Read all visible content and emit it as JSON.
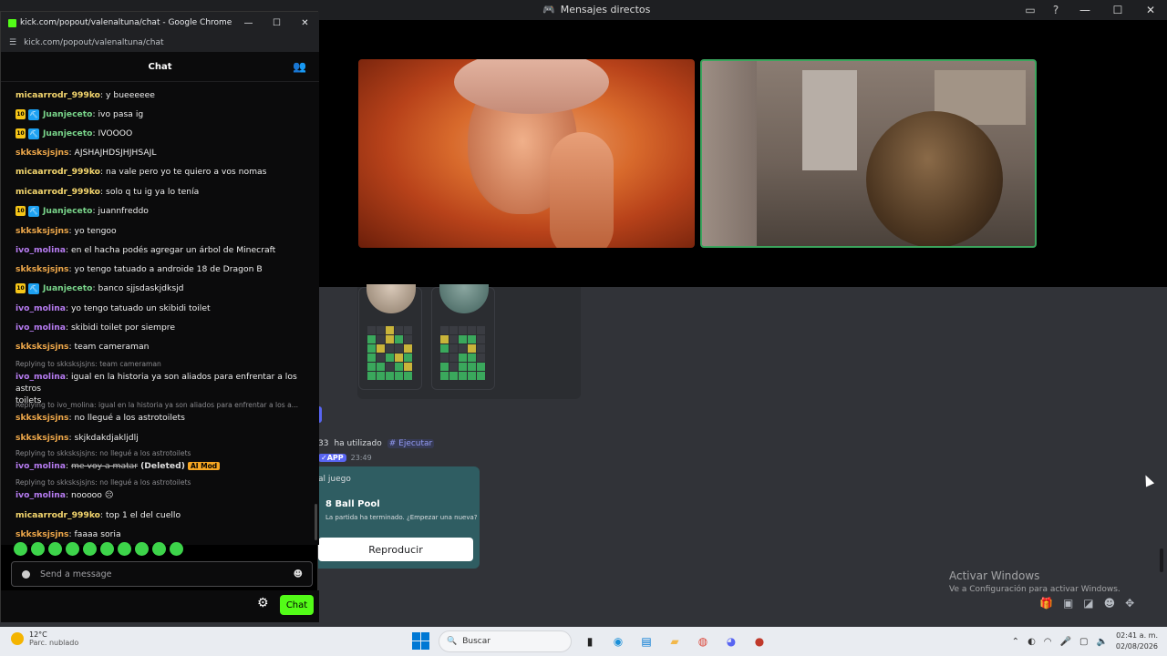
{
  "discord": {
    "window_title": "Mensajes directos",
    "used_text": "ha utilizado",
    "used_prefix": "33",
    "command": "# Ejecutar",
    "app_badge": "✓APP",
    "app_time": "23:49",
    "embed_label": "al juego",
    "embed_title": "8 Ball Pool",
    "embed_desc": "La partida ha terminado. ¿Empezar una nueva?",
    "play_button": "Reproducir",
    "activate_title": "Activar Windows",
    "activate_sub": "Ve a Configuración para activar Windows."
  },
  "chrome": {
    "title": "kick.com/popout/valenaltuna/chat - Google Chrome",
    "url": "kick.com/popout/valenaltuna/chat",
    "min": "—",
    "max": "☐",
    "close": "✕"
  },
  "chat": {
    "header": "Chat",
    "messages": [
      {
        "user": "micaarrodr_999ko",
        "text": "y bueeeeee",
        "color": "#f5d76e"
      },
      {
        "user": "Juanjeceto",
        "text": "ivo pasa ig",
        "color": "#7ad68b"
      },
      {
        "user": "Juanjeceto",
        "text": "IVOOOO",
        "color": "#7ad68b"
      },
      {
        "user": "skksksjsjns",
        "text": "AJSHAJHDSJHJHSAJL",
        "color": "#f0a94b"
      },
      {
        "user": "micaarrodr_999ko",
        "text": "na vale pero yo te quiero a vos nomas",
        "color": "#f5d76e"
      },
      {
        "user": "micaarrodr_999ko",
        "text": "solo q tu ig ya lo tenía",
        "color": "#f5d76e"
      },
      {
        "user": "Juanjeceto",
        "text": "juannfreddo",
        "color": "#7ad68b"
      },
      {
        "user": "skksksjsjns",
        "text": "yo tengoo",
        "color": "#f0a94b"
      },
      {
        "user": "ivo_molina",
        "text": "en el hacha podés agregar un árbol de Minecraft",
        "color": "#b77cf2"
      },
      {
        "user": "skksksjsjns",
        "text": "yo tengo tatuado a androide 18 de Dragon B",
        "color": "#f0a94b"
      },
      {
        "user": "Juanjeceto",
        "text": "banco sjjsdaskjdksjd",
        "color": "#7ad68b"
      },
      {
        "user": "ivo_molina",
        "text": "yo tengo tatuado un skibidi toilet",
        "color": "#b77cf2"
      },
      {
        "user": "ivo_molina",
        "text": "skibidi toilet por siempre",
        "color": "#b77cf2"
      },
      {
        "user": "skksksjsjns",
        "text": "team cameraman",
        "color": "#f0a94b"
      },
      {
        "reply": "Replying to skksksjsjns: team cameraman"
      },
      {
        "user": "ivo_molina",
        "text": "igual en la historia ya son aliados para enfrentar a los astros",
        "text2": "toilets",
        "color": "#b77cf2"
      },
      {
        "reply": "Replying to ivo_molina: igual en la historia ya son aliados para enfrentar a los a..."
      },
      {
        "user": "skksksjsjns",
        "text": "no llegué a los astrotoilets",
        "color": "#f0a94b"
      },
      {
        "user": "skksksjsjns",
        "text": "skjkdakdjakljdlj",
        "color": "#f0a94b"
      },
      {
        "reply": "Replying to skksksjsjns: no llegué a los astrotoilets"
      },
      {
        "user": "ivo_molina",
        "text": "me voy a matar",
        "deleted": "(Deleted)",
        "aimod": "AI Mod",
        "color": "#b77cf2"
      },
      {
        "reply": "Replying to skksksjsjns: no llegué a los astrotoilets"
      },
      {
        "user": "ivo_molina",
        "text": "nooooo",
        "color": "#b77cf2"
      },
      {
        "user": "micaarrodr_999ko",
        "text": "top 1 el del cuello",
        "color": "#f5d76e"
      },
      {
        "user": "skksksjsjns",
        "text": "faaaa soria",
        "color": "#f0a94b"
      }
    ],
    "input_placeholder": "Send a message",
    "send_label": "Chat"
  },
  "taskbar": {
    "temp": "12°C",
    "weather": "Parc. nublado",
    "search": "Buscar",
    "time": "02:41 a. m.",
    "date": "02/08/2026"
  }
}
